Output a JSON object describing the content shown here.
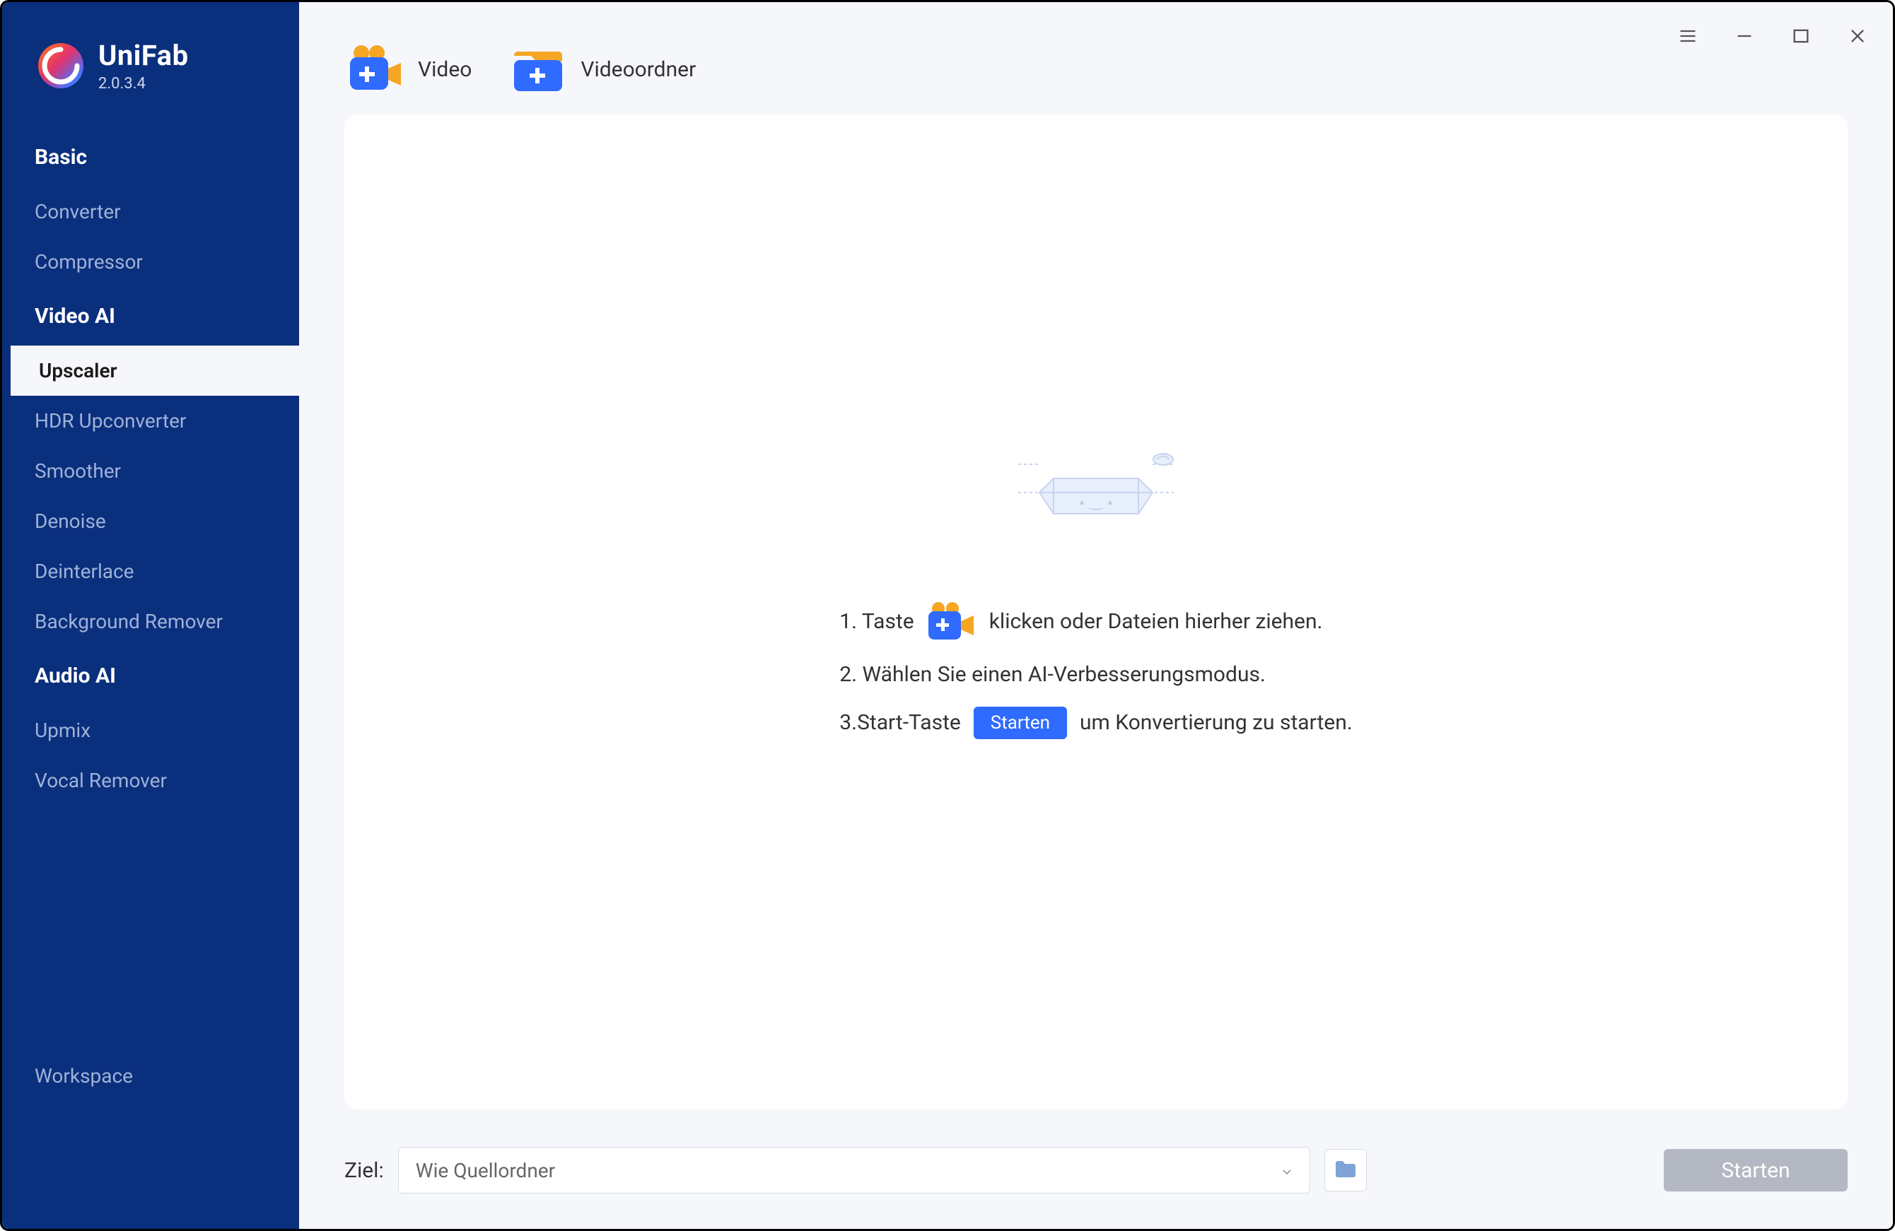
{
  "brand": {
    "name": "UniFab",
    "version": "2.0.3.4"
  },
  "sidebar": {
    "sections": [
      {
        "title": "Basic",
        "items": [
          {
            "label": "Converter",
            "active": false
          },
          {
            "label": "Compressor",
            "active": false
          }
        ]
      },
      {
        "title": "Video AI",
        "items": [
          {
            "label": "Upscaler",
            "active": true
          },
          {
            "label": "HDR Upconverter",
            "active": false
          },
          {
            "label": "Smoother",
            "active": false
          },
          {
            "label": "Denoise",
            "active": false
          },
          {
            "label": "Deinterlace",
            "active": false
          },
          {
            "label": "Background Remover",
            "active": false
          }
        ]
      },
      {
        "title": "Audio AI",
        "items": [
          {
            "label": "Upmix",
            "active": false
          },
          {
            "label": "Vocal Remover",
            "active": false
          }
        ]
      }
    ],
    "workspace_label": "Workspace"
  },
  "top_actions": {
    "video_label": "Video",
    "folder_label": "Videoordner"
  },
  "instructions": {
    "line1_prefix": "1. Taste",
    "line1_suffix": "klicken oder Dateien hierher ziehen.",
    "line2": "2. Wählen Sie einen AI-Verbesserungsmodus.",
    "line3_prefix": "3.Start-Taste",
    "line3_button": "Starten",
    "line3_suffix": "um Konvertierung zu starten."
  },
  "footer": {
    "dest_label": "Ziel:",
    "dest_value": "Wie Quellordner",
    "start_label": "Starten"
  },
  "icons": {
    "menu": "menu-icon",
    "minimize": "minimize-icon",
    "maximize": "maximize-icon",
    "close": "close-icon",
    "folder": "folder-icon",
    "chevron_down": "chevron-down-icon"
  }
}
